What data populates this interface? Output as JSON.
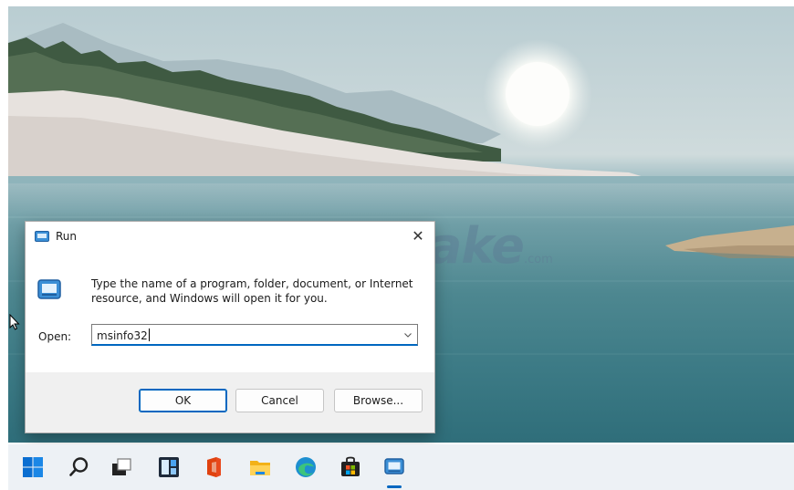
{
  "watermark": {
    "brand": "TipsMake",
    "suffix": ".com"
  },
  "dialog": {
    "title": "Run",
    "close_glyph": "✕",
    "description": "Type the name of a program, folder, document, or Internet resource, and Windows will open it for you.",
    "open_label": "Open:",
    "open_value": "msinfo32",
    "buttons": {
      "ok": "OK",
      "cancel": "Cancel",
      "browse": "Browse..."
    }
  },
  "taskbar": {
    "items": [
      {
        "name": "start-icon"
      },
      {
        "name": "search-icon"
      },
      {
        "name": "task-view-icon"
      },
      {
        "name": "widgets-icon"
      },
      {
        "name": "office-icon"
      },
      {
        "name": "file-explorer-icon"
      },
      {
        "name": "edge-icon"
      },
      {
        "name": "store-icon"
      },
      {
        "name": "run-taskbar-icon",
        "active": true
      }
    ]
  },
  "colors": {
    "accent": "#0067c0",
    "taskbar": "#edf1f5",
    "dialog_footer": "#f0f0f0"
  }
}
